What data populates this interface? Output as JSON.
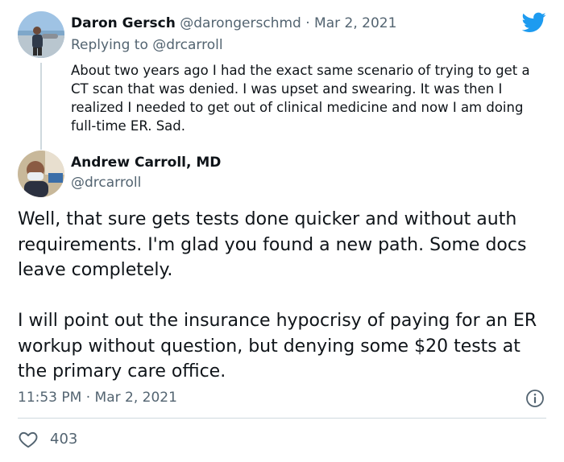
{
  "reply_tweet": {
    "author_name": "Daron Gersch",
    "author_handle": "@darongerschmd",
    "separator": " · ",
    "date": "Mar 2, 2021",
    "replying_to_prefix": "Replying to ",
    "replying_to_handle": "@drcarroll",
    "text": "About two years ago I had the exact same scenario of trying to get a CT scan that was denied. I was upset and swearing. It was then I realized I needed to get out of clinical medicine and now I am doing full-time ER. Sad."
  },
  "main_tweet": {
    "author_name": "Andrew Carroll, MD",
    "author_handle": "@drcarroll",
    "paragraphs": [
      "Well, that sure gets tests done quicker and without auth requirements. I'm glad you found a new path. Some docs leave completely.",
      "I will point out the insurance hypocrisy of paying for an ER workup without question, but denying some $20 tests at the primary care office."
    ],
    "timestamp": "11:53 PM · Mar 2, 2021",
    "like_count": "403"
  },
  "icons": {
    "brand": "twitter-bird-icon",
    "info": "info-icon",
    "like": "heart-icon"
  },
  "colors": {
    "brand_blue": "#1d9bf0",
    "muted_text": "#536471",
    "body_text": "#0f1419",
    "divider": "#cfd9de"
  }
}
